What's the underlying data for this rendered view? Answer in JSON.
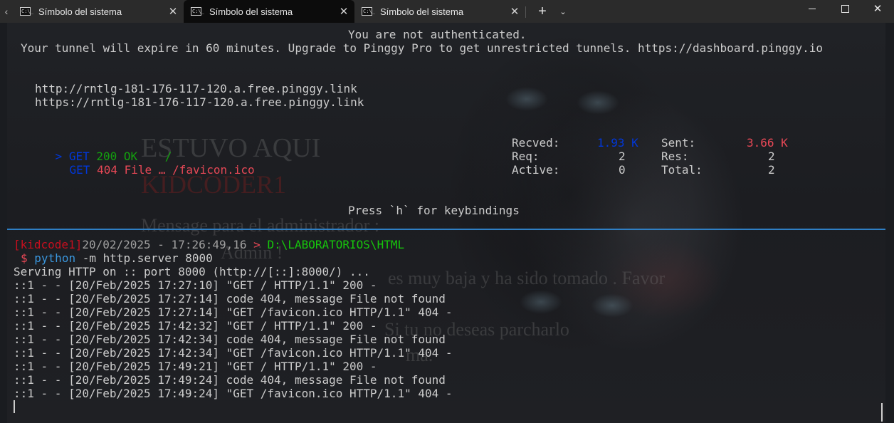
{
  "tabs": [
    {
      "title": "Símbolo del sistema",
      "icon": "cmd-icon",
      "active": false
    },
    {
      "title": "Símbolo del sistema",
      "icon": "cmd-icon",
      "active": true
    },
    {
      "title": "Símbolo del sistema",
      "icon": "cmd-icon",
      "active": false
    }
  ],
  "tab_icon_text": "C:\\_",
  "tabbar": {
    "scroll_left": "‹",
    "close": "✕",
    "new_tab": "+",
    "dropdown": "⌄"
  },
  "window": {
    "minimize": "",
    "maximize": "",
    "close": "✕"
  },
  "pinggy": {
    "auth_line": "You are not authenticated.",
    "expire_line": "Your tunnel will expire in 60 minutes. Upgrade to Pinggy Pro to get unrestricted tunnels. https://dashboard.pinggy.io",
    "urls": [
      "http://rntlg-181-176-117-120.a.free.pinggy.link",
      "https://rntlg-181-176-117-120.a.free.pinggy.link"
    ],
    "requests": [
      {
        "marker": ">",
        "method": "GET",
        "status": "200 OK",
        "path": "/"
      },
      {
        "marker": "",
        "method": "GET",
        "status": "404 File …",
        "path": "/favicon.ico"
      }
    ],
    "stats": {
      "recved_label": "Recved:",
      "recved_value": "1.93 K",
      "sent_label": "Sent:",
      "sent_value": "3.66 K",
      "req_label": "Req:",
      "req_value": "2",
      "res_label": "Res:",
      "res_value": "2",
      "active_label": "Active:",
      "active_value": "0",
      "total_label": "Total:",
      "total_value": "2"
    },
    "help": "Press `h` for keybindings"
  },
  "shell": {
    "user": "[kidcode1]",
    "datetime": "20/02/2025 - 17:26:49,16",
    "arrow": ">",
    "path": "D:\\LABORATORIOS\\HTML",
    "prompt": "$",
    "command_bin": "python",
    "command_args": " -m http.server 8000",
    "output": [
      "Serving HTTP on :: port 8000 (http://[::]:8000/) ...",
      "::1 - - [20/Feb/2025 17:27:10] \"GET / HTTP/1.1\" 200 -",
      "::1 - - [20/Feb/2025 17:27:14] code 404, message File not found",
      "::1 - - [20/Feb/2025 17:27:14] \"GET /favicon.ico HTTP/1.1\" 404 -",
      "::1 - - [20/Feb/2025 17:42:32] \"GET / HTTP/1.1\" 200 -",
      "::1 - - [20/Feb/2025 17:42:34] code 404, message File not found",
      "::1 - - [20/Feb/2025 17:42:34] \"GET /favicon.ico HTTP/1.1\" 404 -",
      "::1 - - [20/Feb/2025 17:49:21] \"GET / HTTP/1.1\" 200 -",
      "::1 - - [20/Feb/2025 17:49:24] code 404, message File not found",
      "::1 - - [20/Feb/2025 17:49:24] \"GET /favicon.ico HTTP/1.1\" 404 -"
    ]
  },
  "background_text": {
    "line1": "ESTUVO AQUI",
    "line2": "KIDCODER1",
    "line3": "Mensage para el administrador :",
    "line4": "Admin !",
    "line5": "es muy baja y ha sido tomado . Favor",
    "line6": "Si tu no deseas parcharlo",
    "line7": "ma."
  },
  "colors": {
    "accent": "#2f7fc4",
    "green": "#13a10e",
    "blue": "#0037da",
    "red": "#e74856"
  }
}
